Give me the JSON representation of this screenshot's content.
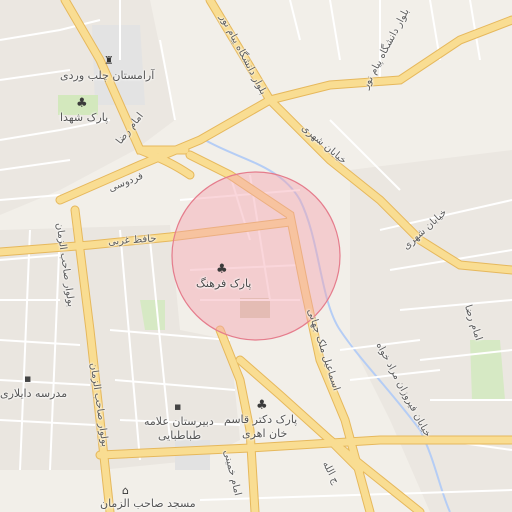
{
  "colors": {
    "background": "#f2efe9",
    "major_road": "#f7d98c",
    "major_road_casing": "#e6b85c",
    "minor_road": "#ffffff",
    "park": "#cfe6b8",
    "building": "#e0d6cc",
    "river": "#b5cdf5",
    "highlight_fill": "#f5a3b0",
    "highlight_stroke": "#e57c8c"
  },
  "streets": {
    "boulevard_payam_noor": "بلوار دانشگاه پیام نور",
    "khiaban_shahri_north": "خیابان شهری",
    "khiaban_shahri_east": "خیابان شهری",
    "imam_reza": "امام رضا",
    "ferdowsi": "فردوسی",
    "hafez_gharbi": "حافظ غربی",
    "saheb_al_zaman": "بولوار صاحب الزمان",
    "esmaeil_malek": "اسماعیل ملک جهانی",
    "forouzan_morad": "خیابان فیروزان مراد خواه",
    "imam_hossein_bottom": "امام خمینی",
    "small_bottom": "ج الله"
  },
  "pois": {
    "park_farhang": "پارک فرهنگ",
    "park_shohada": "پارک شهدا",
    "aramestan": "آرامستان چلب وردی",
    "madrese": "مدرسه دایلاری",
    "dabirestan_line1": "دبیرستان علامه",
    "dabirestan_line2": "طباطبایی",
    "park_ghasem_line1": "پارک دکتر قاسم",
    "park_ghasem_line2": "خان اهری",
    "masjed": "مسجد صاحب الزمان"
  },
  "icons": {
    "park_farhang": "tree-icon",
    "park_shohada": "tree-icon",
    "park_ghasem": "tree-icon",
    "aramestan": "monument-icon",
    "madrese": "school-icon",
    "dabirestan": "school-icon",
    "masjed": "mosque-icon"
  }
}
